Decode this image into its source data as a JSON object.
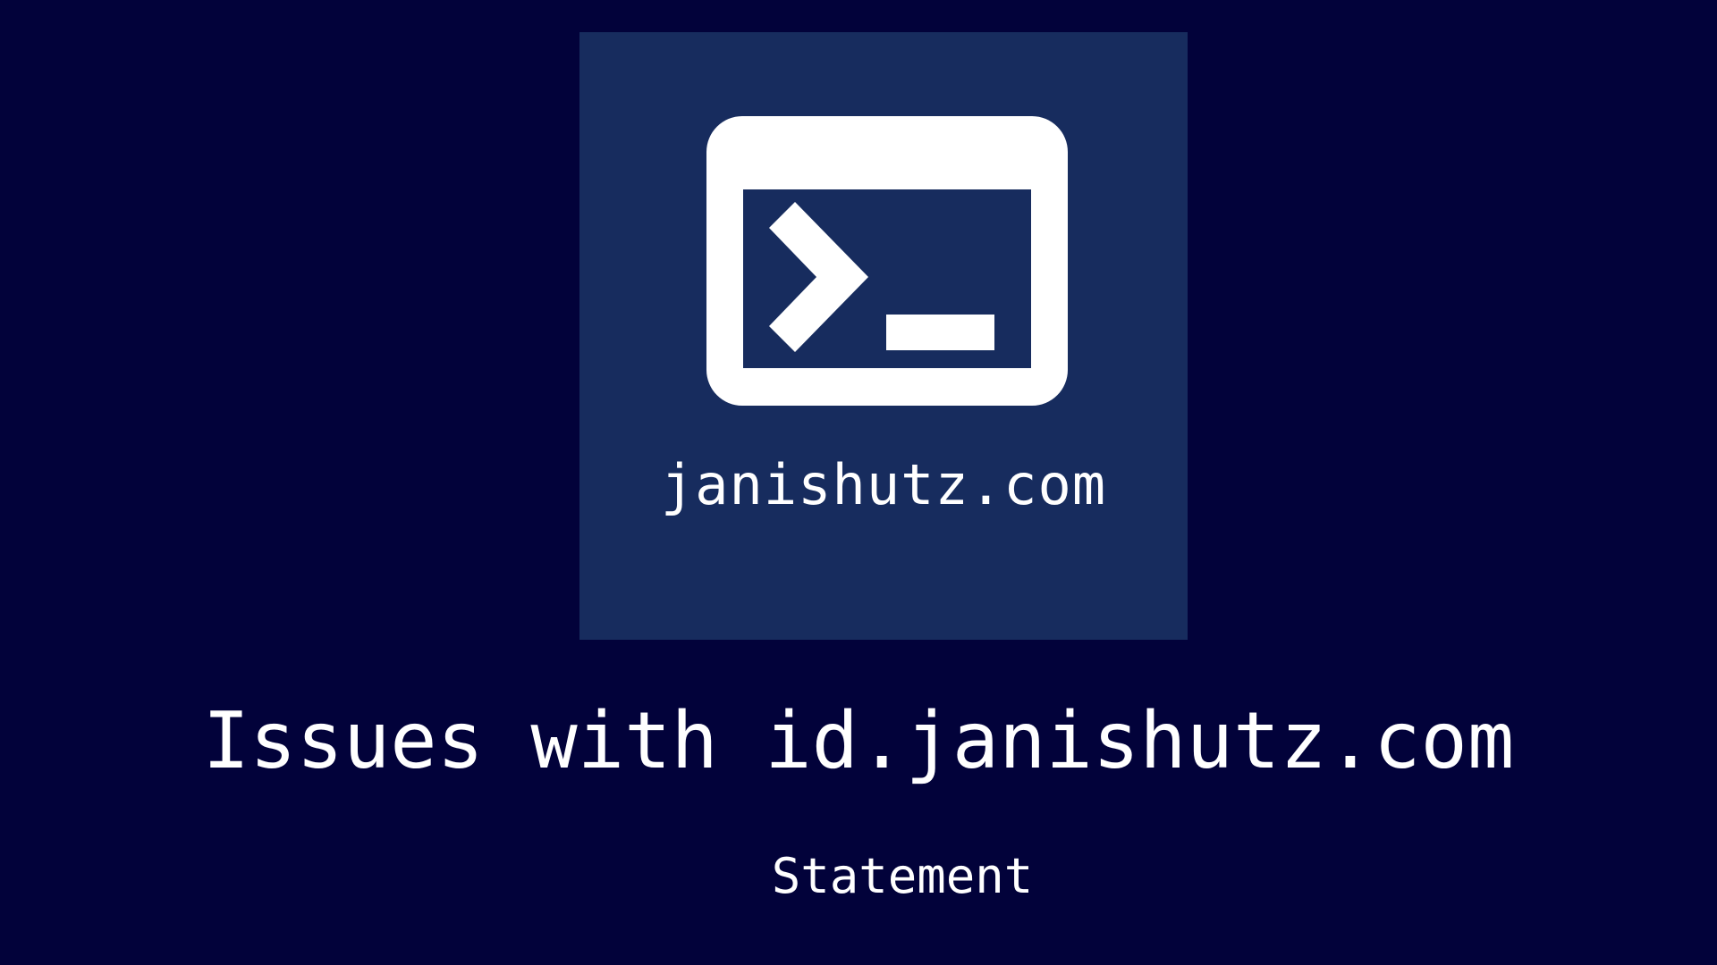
{
  "theme": {
    "background": "#02023a",
    "tile_background": "#172c5e",
    "foreground": "#ffffff"
  },
  "logo": {
    "icon": "terminal-icon",
    "caption": "janishutz.com"
  },
  "header": {
    "title": "Issues with id.janishutz.com",
    "subtitle": "Statement"
  }
}
